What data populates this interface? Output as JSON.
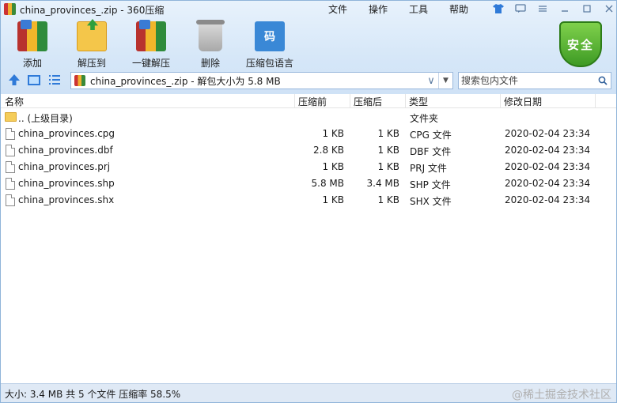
{
  "window": {
    "title": "china_provinces_.zip - 360压缩"
  },
  "menu": [
    "文件",
    "操作",
    "工具",
    "帮助"
  ],
  "toolbar": {
    "add": "添加",
    "extract_to": "解压到",
    "one_click_extract": "一键解压",
    "delete": "删除",
    "code_language": "压缩包语言",
    "code_icon_text": "码"
  },
  "shield": {
    "label": "安全"
  },
  "address": {
    "path": "china_provinces_.zip - 解包大小为 5.8 MB"
  },
  "search": {
    "placeholder": "搜索包内文件"
  },
  "columns": {
    "name": "名称",
    "before": "压缩前",
    "after": "压缩后",
    "type": "类型",
    "modified": "修改日期"
  },
  "files": [
    {
      "name": ".. (上级目录)",
      "before": "",
      "after": "",
      "type": "文件夹",
      "modified": ""
    },
    {
      "name": "china_provinces.cpg",
      "before": "1 KB",
      "after": "1 KB",
      "type": "CPG 文件",
      "modified": "2020-02-04 23:34"
    },
    {
      "name": "china_provinces.dbf",
      "before": "2.8 KB",
      "after": "1 KB",
      "type": "DBF 文件",
      "modified": "2020-02-04 23:34"
    },
    {
      "name": "china_provinces.prj",
      "before": "1 KB",
      "after": "1 KB",
      "type": "PRJ 文件",
      "modified": "2020-02-04 23:34"
    },
    {
      "name": "china_provinces.shp",
      "before": "5.8 MB",
      "after": "3.4 MB",
      "type": "SHP 文件",
      "modified": "2020-02-04 23:34"
    },
    {
      "name": "china_provinces.shx",
      "before": "1 KB",
      "after": "1 KB",
      "type": "SHX 文件",
      "modified": "2020-02-04 23:34"
    }
  ],
  "status": {
    "text": "大小: 3.4 MB 共 5 个文件 压缩率 58.5%",
    "watermark": "@稀土掘金技术社区"
  }
}
